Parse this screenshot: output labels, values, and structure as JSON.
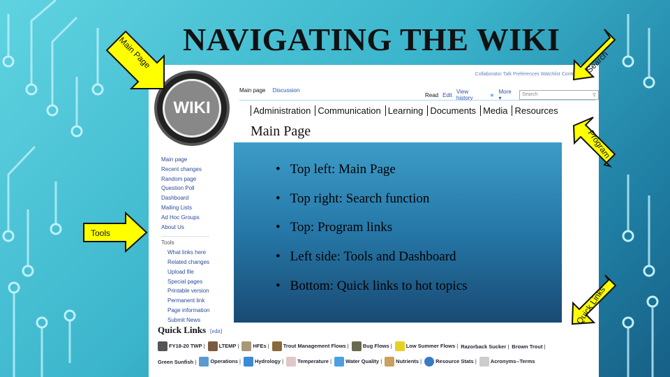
{
  "slide": {
    "title": "NAVIGATING THE WIKI"
  },
  "callouts": {
    "main_page": "Main Page",
    "search": "Search",
    "program": "Program",
    "tools": "Tools",
    "quick_links": "Quick Links"
  },
  "wiki": {
    "logo_text": "WIKI",
    "user_links": "Collaborator  Talk  Preferences  Watchlist  Contributions",
    "tabs": [
      "Main page",
      "Discussion"
    ],
    "actions": [
      "Read",
      "Edit",
      "View history",
      "More ▾"
    ],
    "search_placeholder": "Search",
    "program_links": [
      "Administration",
      "Communication",
      "Learning",
      "Documents",
      "Media",
      "Resources"
    ],
    "page_title": "Main Page",
    "sidebar": [
      "Main page",
      "Recent changes",
      "Random page",
      "Question Poll",
      "Dashboard",
      "Mailing Lists",
      "Ad Hoc Groups",
      "About Us"
    ],
    "tools_heading": "Tools",
    "tools": [
      "What links here",
      "Related changes",
      "Upload file",
      "Special pages",
      "Printable version",
      "Permanent link",
      "Page information",
      "Submit News"
    ],
    "quick_links_title": "Quick Links",
    "quick_links_edit": "[edit]",
    "quick_links_row1": [
      "FY18-20 TWP",
      "LTEMP",
      "HFEs",
      "Trout Management Flows",
      "Bug Flows",
      "Low Summer Flows",
      "Razorback Sucker",
      "Brown Trout"
    ],
    "quick_links_row2": [
      "Green Sunfish",
      "Operations",
      "Hydrology",
      "Temperature",
      "Water Quality",
      "Nutrients",
      "Resource Stats",
      "Acronyms--Terms"
    ]
  },
  "bullets": [
    "Top left: Main Page",
    "Top right: Search function",
    "Top: Program links",
    "Left side: Tools and Dashboard",
    "Bottom: Quick links to hot topics"
  ],
  "colors": {
    "arrow": "#ffff00",
    "link": "#2a52a8"
  }
}
